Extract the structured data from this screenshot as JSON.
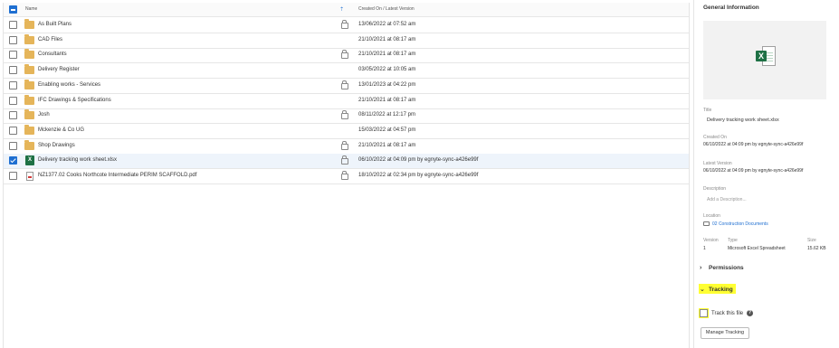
{
  "list": {
    "header": {
      "name_label": "Name",
      "date_label": "Created On / Latest Version",
      "sort_icon": "sort-up-icon"
    },
    "rows": [
      {
        "name": "As Built Plans",
        "type": "folder",
        "locked": true,
        "date": "13/06/2022 at 07:52 am",
        "selected": false
      },
      {
        "name": "CAD Files",
        "type": "folder",
        "locked": false,
        "date": "21/10/2021 at 08:17 am",
        "selected": false
      },
      {
        "name": "Consultants",
        "type": "folder",
        "locked": true,
        "date": "21/10/2021 at 08:17 am",
        "selected": false
      },
      {
        "name": "Delivery Register",
        "type": "folder",
        "locked": false,
        "date": "03/05/2022 at 10:05 am",
        "selected": false
      },
      {
        "name": "Enabling works - Services",
        "type": "folder",
        "locked": true,
        "date": "13/01/2023 at 04:22 pm",
        "selected": false
      },
      {
        "name": "IFC Drawings & Specifications",
        "type": "folder",
        "locked": false,
        "date": "21/10/2021 at 08:17 am",
        "selected": false
      },
      {
        "name": "Josh",
        "type": "folder",
        "locked": true,
        "date": "08/11/2022 at 12:17 pm",
        "selected": false
      },
      {
        "name": "Mckenzie & Co UG",
        "type": "folder",
        "locked": false,
        "date": "15/03/2022 at 04:57 pm",
        "selected": false
      },
      {
        "name": "Shop Drawings",
        "type": "folder",
        "locked": true,
        "date": "21/10/2021 at 08:17 am",
        "selected": false
      },
      {
        "name": "Delivery tracking work sheet.xlsx",
        "type": "xlsx",
        "locked": true,
        "date": "06/10/2022 at 04:09 pm by egnyte-sync-a426e99f",
        "selected": true
      },
      {
        "name": "NZ1377.02 Cooks Northcote Intermediate PERIM SCAFFOLD.pdf",
        "type": "pdf",
        "locked": true,
        "date": "18/10/2022 at 02:34 pm by egnyte-sync-a426e99f",
        "selected": false
      }
    ]
  },
  "panel": {
    "title": "General Information",
    "preview_icon": "excel-file-icon",
    "preview_badge": "X",
    "title_label": "Title",
    "title_value": "Delivery tracking work sheet.xlsx",
    "created_label": "Created On",
    "created_value": "06/10/2022 at 04:09 pm by egnyte-sync-a426e99f",
    "latest_label": "Latest Version",
    "latest_value": "06/10/2022 at 04:09 pm by egnyte-sync-a426e99f",
    "description_label": "Description",
    "description_placeholder": "Add a Description...",
    "location_label": "Location",
    "location_value": "02 Construction Documents",
    "version_label": "Version",
    "type_label": "Type",
    "size_label": "Size",
    "version_value": "1",
    "type_value": "Microsoft Excel Spreadsheet",
    "size_value": "15.62 KB",
    "permissions_label": "Permissions",
    "tracking_label": "Tracking",
    "track_file_label": "Track this file",
    "help_glyph": "?",
    "manage_button": "Manage Tracking",
    "highlight_color": "#ffff33"
  }
}
